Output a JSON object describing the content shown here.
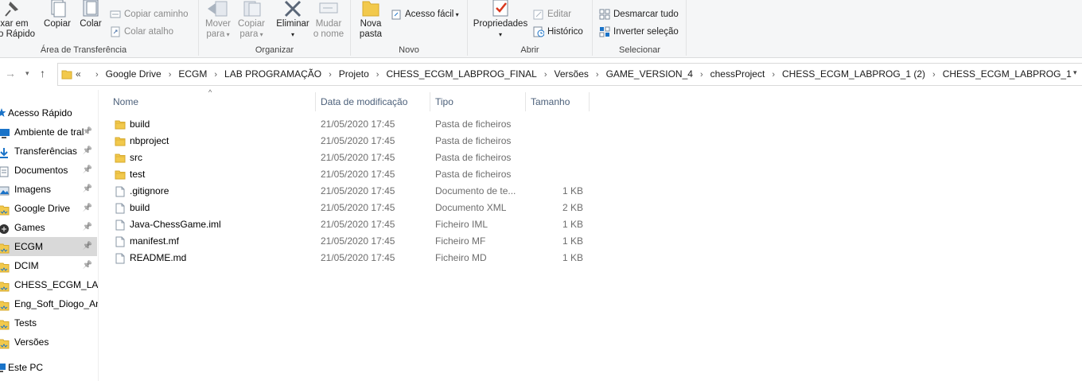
{
  "ribbon": {
    "clipboard": {
      "group_label": "Área de Transferência",
      "pin_line1": "xar em",
      "pin_line2": "o Rápido",
      "copy": "Copiar",
      "paste": "Colar",
      "copy_path": "Copiar caminho",
      "paste_shortcut": "Colar atalho"
    },
    "organize": {
      "group_label": "Organizar",
      "move_line1": "Mover",
      "move_line2": "para",
      "copy_line1": "Copiar",
      "copy_line2": "para",
      "delete": "Eliminar",
      "rename_line1": "Mudar",
      "rename_line2": "o nome"
    },
    "new": {
      "group_label": "Novo",
      "new_folder_line1": "Nova",
      "new_folder_line2": "pasta",
      "easy_access": "Acesso fácil"
    },
    "open": {
      "group_label": "Abrir",
      "properties": "Propriedades",
      "edit": "Editar",
      "history": "Histórico"
    },
    "select": {
      "group_label": "Selecionar",
      "select_none": "Desmarcar tudo",
      "invert_selection": "Inverter seleção"
    }
  },
  "address": {
    "overflow": "«",
    "crumbs": [
      "Google Drive",
      "ECGM",
      "LAB PROGRAMAÇÃO",
      "Projeto",
      "CHESS_ECGM_LABPROG_FINAL",
      "Versões",
      "GAME_VERSION_4",
      "chessProject",
      "CHESS_ECGM_LABPROG_1 (2)",
      "CHESS_ECGM_LABPROG_1"
    ]
  },
  "nav": {
    "quick_access": "Acesso Rápido",
    "items": [
      {
        "label": "Ambiente de tral",
        "pinned": true
      },
      {
        "label": "Transferências",
        "pinned": true
      },
      {
        "label": "Documentos",
        "pinned": true
      },
      {
        "label": "Imagens",
        "pinned": true
      },
      {
        "label": "Google Drive",
        "pinned": true
      },
      {
        "label": "Games",
        "pinned": true
      },
      {
        "label": "ECGM",
        "pinned": true
      },
      {
        "label": "DCIM",
        "pinned": true
      },
      {
        "label": "CHESS_ECGM_LABF",
        "pinned": false
      },
      {
        "label": "Eng_Soft_Diogo_An",
        "pinned": false
      },
      {
        "label": "Tests",
        "pinned": false
      },
      {
        "label": "Versões",
        "pinned": false
      }
    ],
    "this_pc": "Este PC"
  },
  "columns": {
    "name": "Nome",
    "date": "Data de modificação",
    "type": "Tipo",
    "size": "Tamanho"
  },
  "files": [
    {
      "name": "build",
      "date": "21/05/2020 17:45",
      "type": "Pasta de ficheiros",
      "size": "",
      "icon": "folder"
    },
    {
      "name": "nbproject",
      "date": "21/05/2020 17:45",
      "type": "Pasta de ficheiros",
      "size": "",
      "icon": "folder"
    },
    {
      "name": "src",
      "date": "21/05/2020 17:45",
      "type": "Pasta de ficheiros",
      "size": "",
      "icon": "folder"
    },
    {
      "name": "test",
      "date": "21/05/2020 17:45",
      "type": "Pasta de ficheiros",
      "size": "",
      "icon": "folder"
    },
    {
      "name": ".gitignore",
      "date": "21/05/2020 17:45",
      "type": "Documento de te...",
      "size": "1 KB",
      "icon": "file"
    },
    {
      "name": "build",
      "date": "21/05/2020 17:45",
      "type": "Documento XML",
      "size": "2 KB",
      "icon": "file"
    },
    {
      "name": "Java-ChessGame.iml",
      "date": "21/05/2020 17:45",
      "type": "Ficheiro IML",
      "size": "1 KB",
      "icon": "file"
    },
    {
      "name": "manifest.mf",
      "date": "21/05/2020 17:45",
      "type": "Ficheiro MF",
      "size": "1 KB",
      "icon": "file"
    },
    {
      "name": "README.md",
      "date": "21/05/2020 17:45",
      "type": "Ficheiro MD",
      "size": "1 KB",
      "icon": "file"
    }
  ],
  "colors": {
    "folder": "#f2c94c",
    "header_text": "#4c607a",
    "selection": "#d9d9d9",
    "accent_blue": "#1a73c8"
  }
}
